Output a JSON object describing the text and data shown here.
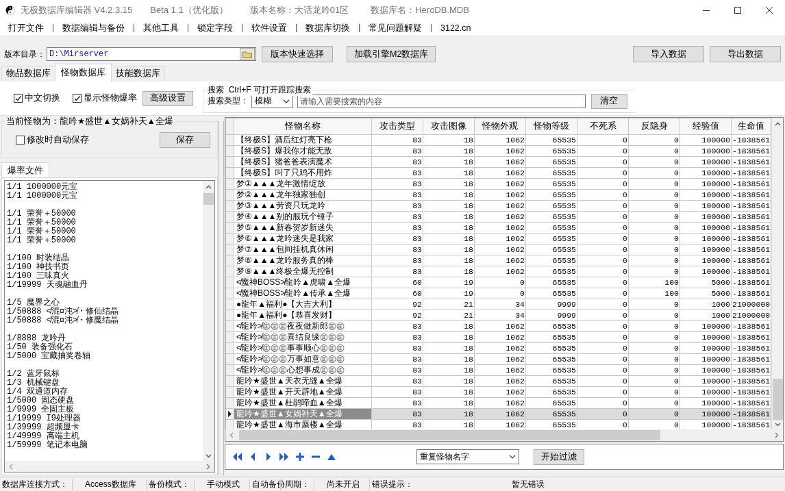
{
  "window": {
    "title_parts": [
      "无极数据库编辑器 V4.2.3.15",
      "Beta 1.1（优化版）",
      "版本名称：大话龙吟01区",
      "数据库名：HeroDB.MDB"
    ]
  },
  "menu": [
    "打开文件",
    "数据编辑与备份",
    "其他工具",
    "锁定字段",
    "软件设置",
    "数据库切换",
    "常见问题解疑",
    "3122.cn"
  ],
  "toolbar": {
    "dir_label": "版本目录：",
    "dir_value": "D:\\Mirserver",
    "buttons": [
      "版本快速选择",
      "加载引擎M2数据库"
    ],
    "right_buttons": [
      "导入数据",
      "导出数据"
    ]
  },
  "tabs": [
    {
      "label": "物品数据库",
      "selected": false
    },
    {
      "label": "怪物数据库",
      "selected": true
    },
    {
      "label": "技能数据库",
      "selected": false
    }
  ],
  "options": {
    "checks": [
      {
        "label": "中文切换",
        "checked": true
      },
      {
        "label": "显示怪物爆率",
        "checked": true
      }
    ],
    "advanced_button": "高级设置",
    "search": {
      "legend": "搜索  Ctrl+F 可打开跟踪搜索",
      "type_label": "搜索类型：",
      "type_value": "模糊",
      "placeholder": "请输入需要搜索的内容",
      "clear_button": "清空"
    }
  },
  "current": {
    "legend": "当前怪物为：龍吟★盛世▲女娲补天▲全爆",
    "autosave": {
      "label": "修改时自动保存",
      "checked": false
    },
    "save_button": "保存"
  },
  "drop_tabs": [
    {
      "label": "爆率文件",
      "selected": true
    }
  ],
  "drop_blocks": [
    {
      "lines": [
        "1/1 1000000元宝",
        "1/1 1000000元宝"
      ]
    },
    {
      "lines": [
        "1/1 荣誉＋50000",
        "1/1 荣誉＋50000",
        "1/1 荣誉＋50000",
        "1/1 荣誉＋50000"
      ]
    },
    {
      "lines": [
        "1/100 时装结晶",
        "1/100 神技书页",
        "1/100 三味真火",
        "1/19999 天魂融血丹"
      ]
    },
    {
      "lines": [
        "1/5 魔界之心",
        "1/50888 ≮混¤沌≯・修仙结晶",
        "1/50888 ≮混¤沌≯・修魔结晶"
      ]
    },
    {
      "lines": [
        "1/8888 龙吟丹",
        "1/50 装备强化石",
        "1/5000 宝藏抽奖卷轴"
      ]
    },
    {
      "lines": [
        "1/2 蓝牙鼠标",
        "1/3 机械键盘",
        "1/4 双通道内存",
        "1/5000 固态硬盘",
        "1/9999 全固主板",
        "1/19999 I9处理器",
        "1/39999 超频显卡",
        "1/49999 高端主机",
        "1/59999 笔记本电脑"
      ]
    }
  ],
  "table": {
    "columns": [
      "怪物名称",
      "攻击类型",
      "攻击图像",
      "怪物外观",
      "怪物等级",
      "不死系",
      "反隐身",
      "经验值",
      "生命值"
    ],
    "rows": [
      {
        "selected": false,
        "cells": [
          "【终极S】酒后红灯亮下枪",
          "83",
          "18",
          "1062",
          "65535",
          "0",
          "0",
          "100000",
          "-1838561"
        ]
      },
      {
        "selected": false,
        "cells": [
          "【终极S】爆我你才能无敌",
          "83",
          "18",
          "1062",
          "65535",
          "0",
          "0",
          "100000",
          "-1838561"
        ]
      },
      {
        "selected": false,
        "cells": [
          "【终极S】猪爸爸表演魔术",
          "83",
          "18",
          "1062",
          "65535",
          "0",
          "0",
          "100000",
          "-1838561"
        ]
      },
      {
        "selected": false,
        "cells": [
          "【终极S】叫了只鸡不用炸",
          "83",
          "18",
          "1062",
          "65535",
          "0",
          "0",
          "100000",
          "-1838561"
        ]
      },
      {
        "selected": false,
        "cells": [
          "梦①▲▲▲龙年激情绽放",
          "83",
          "18",
          "1062",
          "65535",
          "0",
          "0",
          "100000",
          "-1838561"
        ]
      },
      {
        "selected": false,
        "cells": [
          "梦②▲▲▲龙年独家独创",
          "83",
          "18",
          "1062",
          "65535",
          "0",
          "0",
          "100000",
          "-1838561"
        ]
      },
      {
        "selected": false,
        "cells": [
          "梦③▲▲▲劳资只玩龙吟",
          "83",
          "18",
          "1062",
          "65535",
          "0",
          "0",
          "100000",
          "-1838561"
        ]
      },
      {
        "selected": false,
        "cells": [
          "梦④▲▲▲别的服玩个锤子",
          "83",
          "18",
          "1062",
          "65535",
          "0",
          "0",
          "100000",
          "-1838561"
        ]
      },
      {
        "selected": false,
        "cells": [
          "梦⑤▲▲▲新春贺岁新迷失",
          "83",
          "18",
          "1062",
          "65535",
          "0",
          "0",
          "100000",
          "-1838561"
        ]
      },
      {
        "selected": false,
        "cells": [
          "梦⑥▲▲▲龙吟迷失是我家",
          "83",
          "18",
          "1062",
          "65535",
          "0",
          "0",
          "100000",
          "-1838561"
        ]
      },
      {
        "selected": false,
        "cells": [
          "梦⑦▲▲▲包间挂机真休闲",
          "83",
          "18",
          "1062",
          "65535",
          "0",
          "0",
          "100000",
          "-1838561"
        ]
      },
      {
        "selected": false,
        "cells": [
          "梦⑧▲▲▲龙吟服务真的棒",
          "83",
          "18",
          "1062",
          "65535",
          "0",
          "0",
          "100000",
          "-1838561"
        ]
      },
      {
        "selected": false,
        "cells": [
          "梦⑨▲▲▲终极全爆无控制",
          "83",
          "18",
          "1062",
          "65535",
          "0",
          "0",
          "100000",
          "-1838561"
        ]
      },
      {
        "selected": false,
        "cells": [
          "≮魔神BOSS≯龍吟▲虎啸▲全爆",
          "60",
          "19",
          "0",
          "65535",
          "0",
          "100",
          "5000",
          "-1838561"
        ]
      },
      {
        "selected": false,
        "cells": [
          "≮魔神BOSS≯龍吟▲传承▲全爆",
          "60",
          "19",
          "0",
          "65535",
          "0",
          "100",
          "5000",
          "-1838561"
        ]
      },
      {
        "selected": false,
        "cells": [
          "●龍年▲福利●【大吉大利】",
          "92",
          "21",
          "34",
          "9999",
          "0",
          "0",
          "1000",
          "21000000"
        ]
      },
      {
        "selected": false,
        "cells": [
          "●龍年▲福利●【恭喜发财】",
          "92",
          "21",
          "34",
          "9999",
          "0",
          "0",
          "1000",
          "21000000"
        ]
      },
      {
        "selected": false,
        "cells": [
          "≮龍吟≯㊣㊣㊣夜夜做新郎㊣㊣",
          "83",
          "18",
          "1062",
          "65535",
          "0",
          "0",
          "100000",
          "-1838561"
        ]
      },
      {
        "selected": false,
        "cells": [
          "≮龍吟≯㊣㊣㊣喜结良缘㊣㊣㊣",
          "83",
          "18",
          "1062",
          "65535",
          "0",
          "0",
          "100000",
          "-1838561"
        ]
      },
      {
        "selected": false,
        "cells": [
          "≮龍吟≯㊣㊣㊣事事顺心㊣㊣㊣",
          "83",
          "18",
          "1062",
          "65535",
          "0",
          "0",
          "100000",
          "-1838561"
        ]
      },
      {
        "selected": false,
        "cells": [
          "≮龍吟≯㊣㊣㊣万事如意㊣㊣㊣",
          "83",
          "18",
          "1062",
          "65535",
          "0",
          "0",
          "100000",
          "-1838561"
        ]
      },
      {
        "selected": false,
        "cells": [
          "≮龍吟≯㊣㊣㊣心想事成㊣㊣㊣",
          "83",
          "18",
          "1062",
          "65535",
          "0",
          "0",
          "100000",
          "-1838561"
        ]
      },
      {
        "selected": false,
        "cells": [
          "龍吟★盛世▲天衣无缝▲全爆",
          "83",
          "18",
          "1062",
          "65535",
          "0",
          "0",
          "100000",
          "-1838561"
        ]
      },
      {
        "selected": false,
        "cells": [
          "龍吟★盛世▲开天辟地▲全爆",
          "83",
          "18",
          "1062",
          "65535",
          "0",
          "0",
          "100000",
          "-1838561"
        ]
      },
      {
        "selected": false,
        "cells": [
          "龍吟★盛世▲杜鹃啼血▲全爆",
          "83",
          "18",
          "1062",
          "65535",
          "0",
          "0",
          "100000",
          "-1838561"
        ]
      },
      {
        "selected": true,
        "cells": [
          "龍吟★盛世▲女娲补天▲全爆",
          "83",
          "18",
          "1062",
          "65535",
          "0",
          "0",
          "100000",
          "-1838561"
        ]
      },
      {
        "selected": false,
        "cells": [
          "龍吟★盛世▲海市蜃楼▲全爆",
          "83",
          "18",
          "1062",
          "65535",
          "0",
          "0",
          "100000",
          "-1838561"
        ]
      }
    ]
  },
  "filter": {
    "nav": [
      {
        "kind": "first"
      },
      {
        "kind": "prev"
      },
      {
        "kind": "next"
      },
      {
        "kind": "last"
      },
      {
        "kind": "add"
      },
      {
        "kind": "remove"
      },
      {
        "kind": "up"
      }
    ],
    "select_value": "重复怪物名字",
    "button": "开始过滤"
  },
  "status_bar": [
    {
      "label": "数据库连接方式：",
      "value": "Access数据库"
    },
    {
      "label": "备份模式：",
      "value": "手动模式"
    },
    {
      "label": "自动备份周期：",
      "value": "尚未开启"
    },
    {
      "label": "错误提示：",
      "value": "暂无错误"
    }
  ]
}
